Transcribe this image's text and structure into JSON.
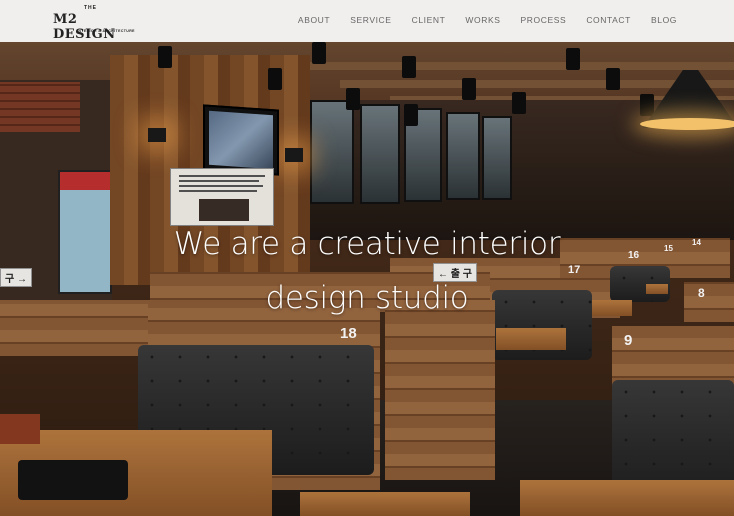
{
  "logo": {
    "the": "THE",
    "name": "M2 DESIGN",
    "tagline": "INTERIOR & ARCHITECTURE"
  },
  "nav": {
    "items": [
      "ABOUT",
      "SERVICE",
      "CLIENT",
      "WORKS",
      "PROCESS",
      "CONTACT",
      "BLOG"
    ]
  },
  "hero": {
    "line1": "We are a creative interior",
    "line2": "design studio"
  },
  "booths": {
    "numbers": [
      "18",
      "17",
      "16",
      "15",
      "14",
      "9",
      "8"
    ],
    "exit_sign": "← 출 구",
    "left_sign": "구 →"
  }
}
